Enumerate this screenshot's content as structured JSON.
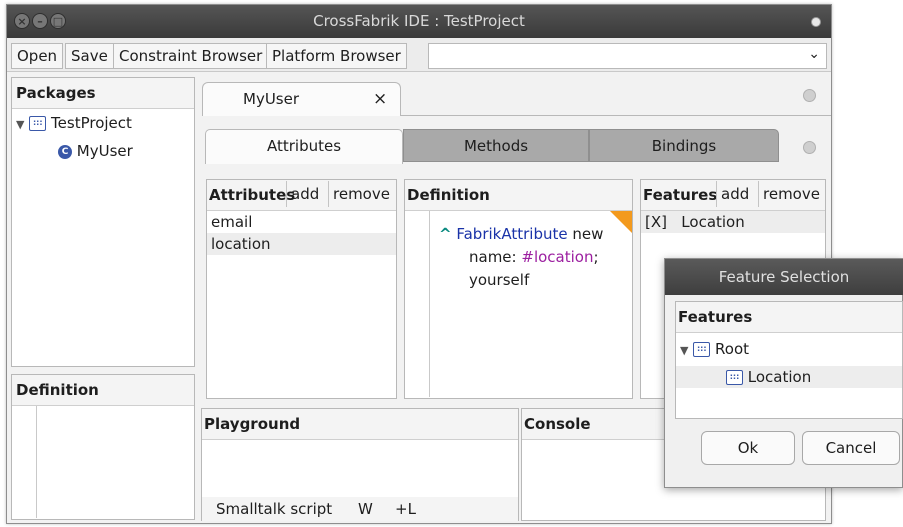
{
  "window": {
    "title": "CrossFabrik IDE : TestProject"
  },
  "toolbar": {
    "buttons": [
      "Open",
      "Save",
      "Constraint Browser",
      "Platform Browser"
    ],
    "combo_icon": "chevron-down-icon"
  },
  "packages": {
    "header": "Packages",
    "tree": [
      {
        "label": "TestProject",
        "icon": "package-icon",
        "expanded": true
      },
      {
        "label": "MyUser",
        "icon": "class-icon"
      }
    ]
  },
  "definition_left": {
    "header": "Definition"
  },
  "editor_tab": {
    "label": "MyUser",
    "close": "×"
  },
  "subtabs": [
    "Attributes",
    "Methods",
    "Bindings"
  ],
  "attributes": {
    "header": "Attributes",
    "add": "add",
    "remove": "remove",
    "items": [
      "email",
      "location"
    ],
    "selected": "location"
  },
  "definition": {
    "header": "Definition",
    "code": {
      "caret": "^",
      "class": "FabrikAttribute",
      "msg1": "new",
      "key": "name:",
      "symbol": "#location",
      "semi": ";",
      "line3": "yourself"
    }
  },
  "features": {
    "header": "Features",
    "add": "add",
    "remove": "remove",
    "items": [
      {
        "check": "[X]",
        "label": "Location"
      }
    ]
  },
  "playground": {
    "header": "Playground",
    "status": [
      "Smalltalk script",
      "W",
      "+L"
    ]
  },
  "console": {
    "header": "Console"
  },
  "dialog": {
    "title": "Feature Selection",
    "header": "Features",
    "tree": [
      {
        "label": "Root",
        "icon": "package-icon",
        "expanded": true
      },
      {
        "label": "Location",
        "icon": "package-icon"
      }
    ],
    "ok": "Ok",
    "cancel": "Cancel"
  },
  "colors": {
    "keyword": "#1a33a8",
    "symbol": "#9c1fa0",
    "caret": "#0a8a80",
    "corner": "#f39a1e"
  }
}
